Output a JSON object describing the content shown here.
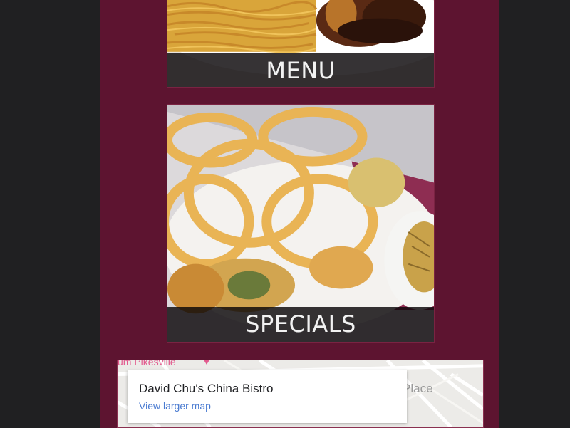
{
  "tiles": {
    "menu": {
      "label": "MENU"
    },
    "specials": {
      "label": "SPECIALS"
    }
  },
  "map": {
    "title": "David Chu's China Bistro",
    "link": "View larger map",
    "place_label": "Place",
    "town_label": "um Pikesville"
  },
  "colors": {
    "page_background": "#202022",
    "content_background": "#5d1430",
    "label_bar": "#0a0608",
    "link": "#4a7bd1"
  }
}
